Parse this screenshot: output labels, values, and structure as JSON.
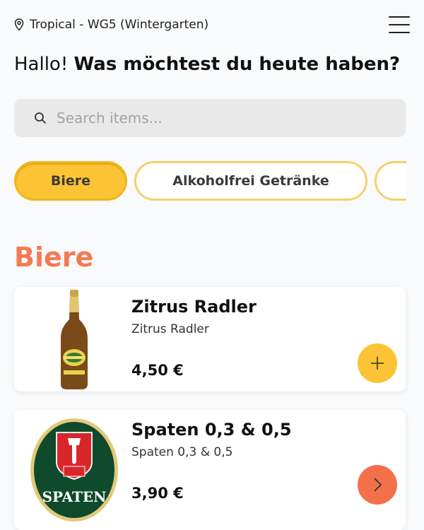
{
  "header": {
    "location": "Tropical - WG5 (Wintergarten)",
    "menu_icon": "hamburger-menu-icon"
  },
  "greeting": {
    "hello": "Hallo!",
    "question": "Was möchtest du heute haben?"
  },
  "search": {
    "placeholder": "Search items...",
    "value": ""
  },
  "categories": [
    {
      "label": "Biere",
      "active": true
    },
    {
      "label": "Alkoholfrei Getränke",
      "active": false
    },
    {
      "label": "",
      "active": false
    }
  ],
  "section": {
    "title": "Biere"
  },
  "products": [
    {
      "name": "Zitrus Radler",
      "description": "Zitrus Radler",
      "price": "4,50 €",
      "action_icon": "plus-icon"
    },
    {
      "name": "Spaten 0,3 & 0,5",
      "description": "Spaten 0,3 & 0,5",
      "price": "3,90 €",
      "action_icon": "chevron-right-icon",
      "logo_text": "SPATEN"
    }
  ],
  "colors": {
    "accent": "#fcc434",
    "chip_border": "#f6d06a",
    "section_title": "#f47a52",
    "secondary_button": "#f4704a",
    "search_bg": "#e9e9ea"
  }
}
